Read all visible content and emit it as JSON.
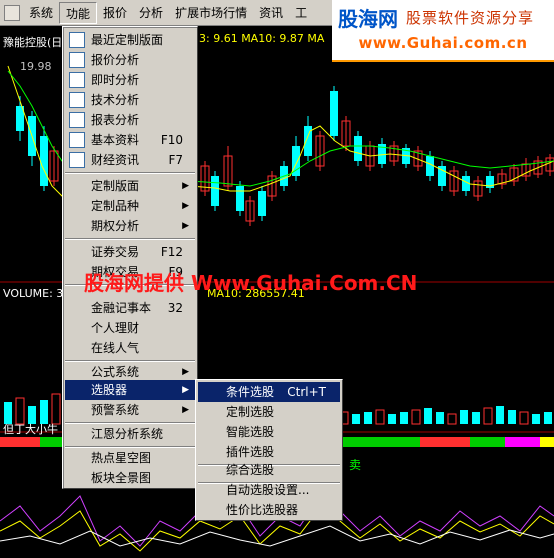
{
  "menubar": {
    "items": [
      "系统",
      "功能",
      "报价",
      "分析",
      "扩展市场行情",
      "资讯",
      "工"
    ],
    "active_index": 1
  },
  "logo": {
    "brand": "股海网",
    "slogan": "股票软件资源分享",
    "url": "www.Guhai.com.cn"
  },
  "chart": {
    "stock_title": "豫能控股(日",
    "price_label": "19.98",
    "ma_top": "3: 9.61  MA10: 9.87  MA",
    "volume_label": "VOLUME: 3",
    "volume_ma": "MA10: 286557.41",
    "indicator_label": "但丁大小牛",
    "sell_label": "卖",
    "colors": {
      "up": "#00ffff",
      "down": "#ff3030",
      "ma5": "#ffff00",
      "ma10": "#00ff00"
    }
  },
  "menu": {
    "items": [
      {
        "label": "最近定制版面",
        "shortcut": "",
        "submenu": false
      },
      {
        "label": "报价分析",
        "shortcut": "",
        "submenu": false
      },
      {
        "label": "即时分析",
        "shortcut": "",
        "submenu": false
      },
      {
        "label": "技术分析",
        "shortcut": "",
        "submenu": false
      },
      {
        "label": "报表分析",
        "shortcut": "",
        "submenu": false
      },
      {
        "label": "基本资料",
        "shortcut": "F10",
        "submenu": false
      },
      {
        "label": "财经资讯",
        "shortcut": "F7",
        "submenu": false
      },
      {
        "label": "定制版面",
        "shortcut": "",
        "submenu": true
      },
      {
        "label": "定制品种",
        "shortcut": "",
        "submenu": true
      },
      {
        "label": "期权分析",
        "shortcut": "",
        "submenu": true
      },
      {
        "label": "证券交易",
        "shortcut": "F12",
        "submenu": false
      },
      {
        "label": "期权交易",
        "shortcut": "F9",
        "submenu": false
      },
      {
        "label": "金融记事本",
        "shortcut": "32",
        "submenu": false
      },
      {
        "label": "个人理财",
        "shortcut": "",
        "submenu": false
      },
      {
        "label": "在线人气",
        "shortcut": "",
        "submenu": false
      },
      {
        "label": "公式系统",
        "shortcut": "",
        "submenu": true
      },
      {
        "label": "选股器",
        "shortcut": "",
        "submenu": true
      },
      {
        "label": "预警系统",
        "shortcut": "",
        "submenu": true
      },
      {
        "label": "江恩分析系统",
        "shortcut": "",
        "submenu": false
      },
      {
        "label": "热点星空图",
        "shortcut": "",
        "submenu": false
      },
      {
        "label": "板块全景图",
        "shortcut": "",
        "submenu": false
      }
    ]
  },
  "submenu": {
    "items": [
      {
        "label": "条件选股",
        "shortcut": "Ctrl+T"
      },
      {
        "label": "定制选股",
        "shortcut": ""
      },
      {
        "label": "智能选股",
        "shortcut": ""
      },
      {
        "label": "插件选股",
        "shortcut": ""
      },
      {
        "label": "综合选股",
        "shortcut": ""
      },
      {
        "label": "自动选股设置...",
        "shortcut": ""
      },
      {
        "label": "性价比选股器",
        "shortcut": ""
      }
    ]
  },
  "watermark": "股海网提供 Www.Guhai.Com.CN"
}
